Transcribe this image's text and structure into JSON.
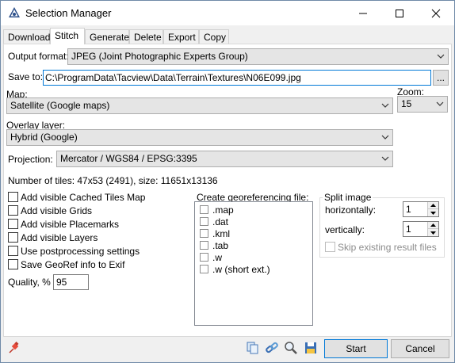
{
  "window": {
    "title": "Selection Manager"
  },
  "tabs": [
    "Download",
    "Stitch",
    "Generate",
    "Delete",
    "Export",
    "Copy"
  ],
  "active_tab": "Stitch",
  "output_format": {
    "label": "Output format:",
    "value": "JPEG (Joint Photographic Experts Group)"
  },
  "save_to": {
    "label": "Save to:",
    "value": "C:\\ProgramData\\Tacview\\Data\\Terrain\\Textures\\N06E099.jpg",
    "browse_label": "..."
  },
  "map": {
    "label": "Map:",
    "value": "Satellite (Google maps)"
  },
  "zoom": {
    "label": "Zoom:",
    "value": "15"
  },
  "overlay": {
    "label": "Overlay layer:",
    "value": "Hybrid (Google)"
  },
  "projection": {
    "label": "Projection:",
    "value": "Mercator / WGS84 / EPSG:3395"
  },
  "tiles_info": "Number of tiles: 47x53 (2491), size: 11651x13136",
  "options": [
    {
      "label": "Add visible Cached Tiles Map",
      "checked": false
    },
    {
      "label": "Add visible Grids",
      "checked": false
    },
    {
      "label": "Add visible Placemarks",
      "checked": false
    },
    {
      "label": "Add visible Layers",
      "checked": false
    },
    {
      "label": "Use postprocessing settings",
      "checked": false
    },
    {
      "label": "Save GeoRef info to Exif",
      "checked": false
    }
  ],
  "quality": {
    "label": "Quality, %",
    "value": "95"
  },
  "georef": {
    "label": "Create georeferencing file:",
    "items": [
      ".map",
      ".dat",
      ".kml",
      ".tab",
      ".w",
      ".w (short ext.)"
    ]
  },
  "split": {
    "label": "Split image",
    "horizontally_label": "horizontally:",
    "horizontally_value": "1",
    "vertically_label": "vertically:",
    "vertically_value": "1",
    "skip_label": "Skip existing result files"
  },
  "buttons": {
    "start": "Start",
    "cancel": "Cancel"
  },
  "icons": [
    "pin-icon",
    "copy-icon",
    "link-icon",
    "zoom-icon",
    "save-icon"
  ],
  "colors": {
    "accent": "#0078d7",
    "window_bg": "#f0f0f0"
  }
}
